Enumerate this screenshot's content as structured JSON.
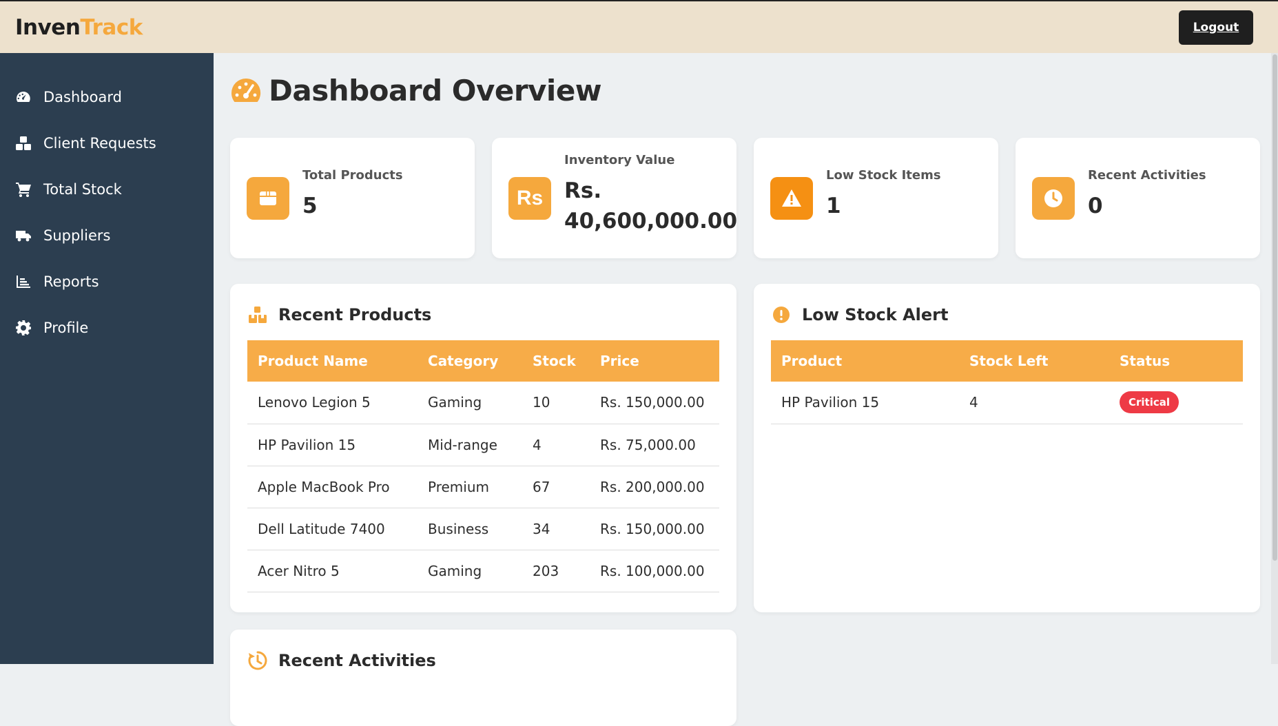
{
  "app": {
    "logo_part1": "Inven",
    "logo_part2": "Track",
    "logout_label": "Logout"
  },
  "colors": {
    "accent": "#f5a83d",
    "sidebar": "#2c3e50",
    "topbar": "#ede1cd",
    "critical": "#ee3a45"
  },
  "sidebar": {
    "items": [
      {
        "label": "Dashboard",
        "icon": "gauge-icon"
      },
      {
        "label": "Client Requests",
        "icon": "boxes-icon"
      },
      {
        "label": "Total Stock",
        "icon": "cart-icon"
      },
      {
        "label": "Suppliers",
        "icon": "truck-icon"
      },
      {
        "label": "Reports",
        "icon": "chart-icon"
      },
      {
        "label": "Profile",
        "icon": "gear-icon"
      }
    ]
  },
  "main": {
    "title": "Dashboard Overview",
    "stats": [
      {
        "label": "Total Products",
        "value": "5",
        "icon": "box-icon"
      },
      {
        "label": "Inventory Value",
        "value_line1": "Rs.",
        "value_line2": "40,600,000.00",
        "icon_text": "Rs",
        "icon": "rupee-icon"
      },
      {
        "label": "Low Stock Items",
        "value": "1",
        "icon": "warning-icon"
      },
      {
        "label": "Recent Activities",
        "value": "0",
        "icon": "clock-icon"
      }
    ],
    "recent_products": {
      "title": "Recent Products",
      "columns": [
        "Product Name",
        "Category",
        "Stock",
        "Price"
      ],
      "rows": [
        [
          "Lenovo Legion 5",
          "Gaming",
          "10",
          "Rs. 150,000.00"
        ],
        [
          "HP Pavilion 15",
          "Mid-range",
          "4",
          "Rs. 75,000.00"
        ],
        [
          "Apple MacBook Pro",
          "Premium",
          "67",
          "Rs. 200,000.00"
        ],
        [
          "Dell Latitude 7400",
          "Business",
          "34",
          "Rs. 150,000.00"
        ],
        [
          "Acer Nitro 5",
          "Gaming",
          "203",
          "Rs. 100,000.00"
        ]
      ]
    },
    "low_stock": {
      "title": "Low Stock Alert",
      "columns": [
        "Product",
        "Stock Left",
        "Status"
      ],
      "rows": [
        {
          "product": "HP Pavilion 15",
          "stock_left": "4",
          "status": "Critical"
        }
      ]
    },
    "recent_activities": {
      "title": "Recent Activities"
    }
  }
}
